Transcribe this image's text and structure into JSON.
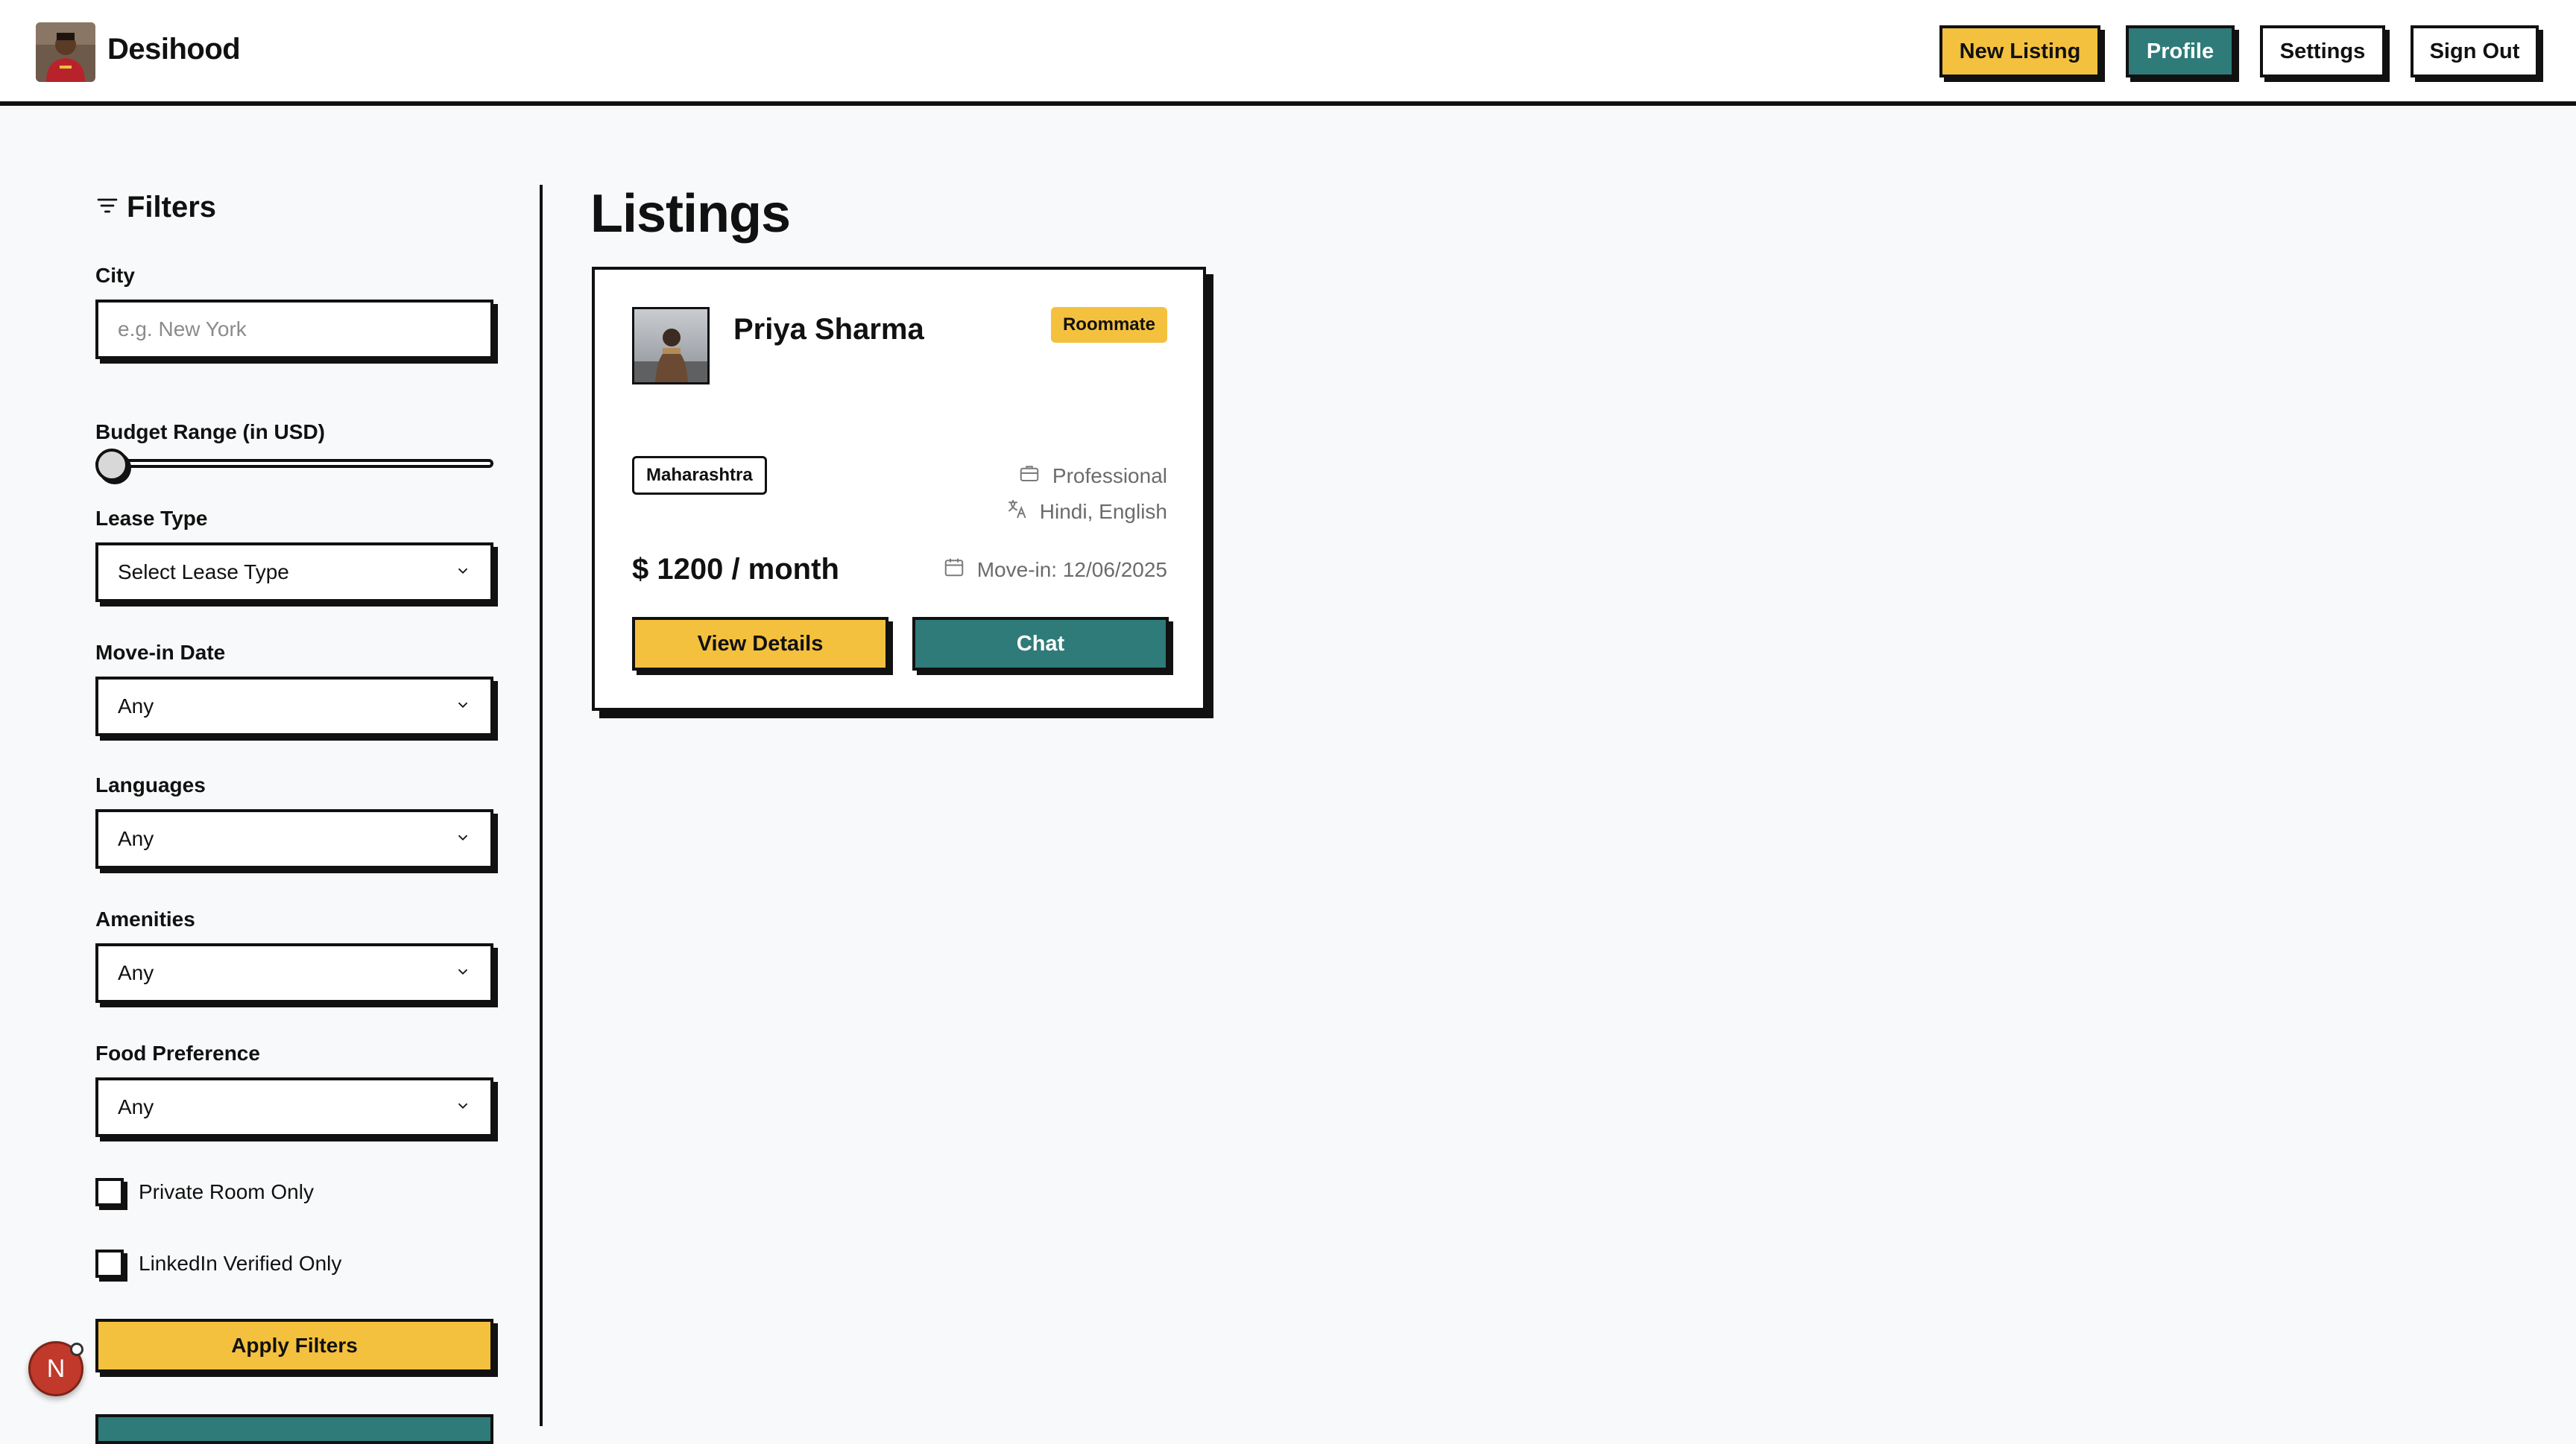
{
  "header": {
    "brand": "Desihood",
    "buttons": {
      "new_listing": "New Listing",
      "profile": "Profile",
      "settings": "Settings",
      "sign_out": "Sign Out"
    }
  },
  "sidebar": {
    "title": "Filters",
    "city": {
      "label": "City",
      "placeholder": "e.g. New York"
    },
    "budget": {
      "label": "Budget Range (in USD)",
      "level": 0
    },
    "lease_type": {
      "label": "Lease Type",
      "value": "Select Lease Type"
    },
    "move_in": {
      "label": "Move-in Date",
      "value": "Any"
    },
    "languages": {
      "label": "Languages",
      "value": "Any"
    },
    "amenities": {
      "label": "Amenities",
      "value": "Any"
    },
    "food": {
      "label": "Food Preference",
      "value": "Any"
    },
    "private_room": {
      "label": "Private Room Only",
      "checked": false
    },
    "linkedin": {
      "label": "LinkedIn Verified Only",
      "checked": false
    },
    "apply": "Apply Filters"
  },
  "floating_badge": {
    "letter": "N"
  },
  "main": {
    "title": "Listings",
    "listings": [
      {
        "name": "Priya Sharma",
        "type": "Roommate",
        "region": "Maharashtra",
        "occupation": "Professional",
        "languages": "Hindi, English",
        "price": "$ 1200 / month",
        "move_in": "Move-in: 12/06/2025",
        "view_details": "View Details",
        "chat": "Chat"
      }
    ]
  },
  "colors": {
    "accent_yellow": "#f4c13e",
    "accent_teal": "#2f7b79",
    "border": "#111111",
    "background": "#f8f9fa"
  }
}
